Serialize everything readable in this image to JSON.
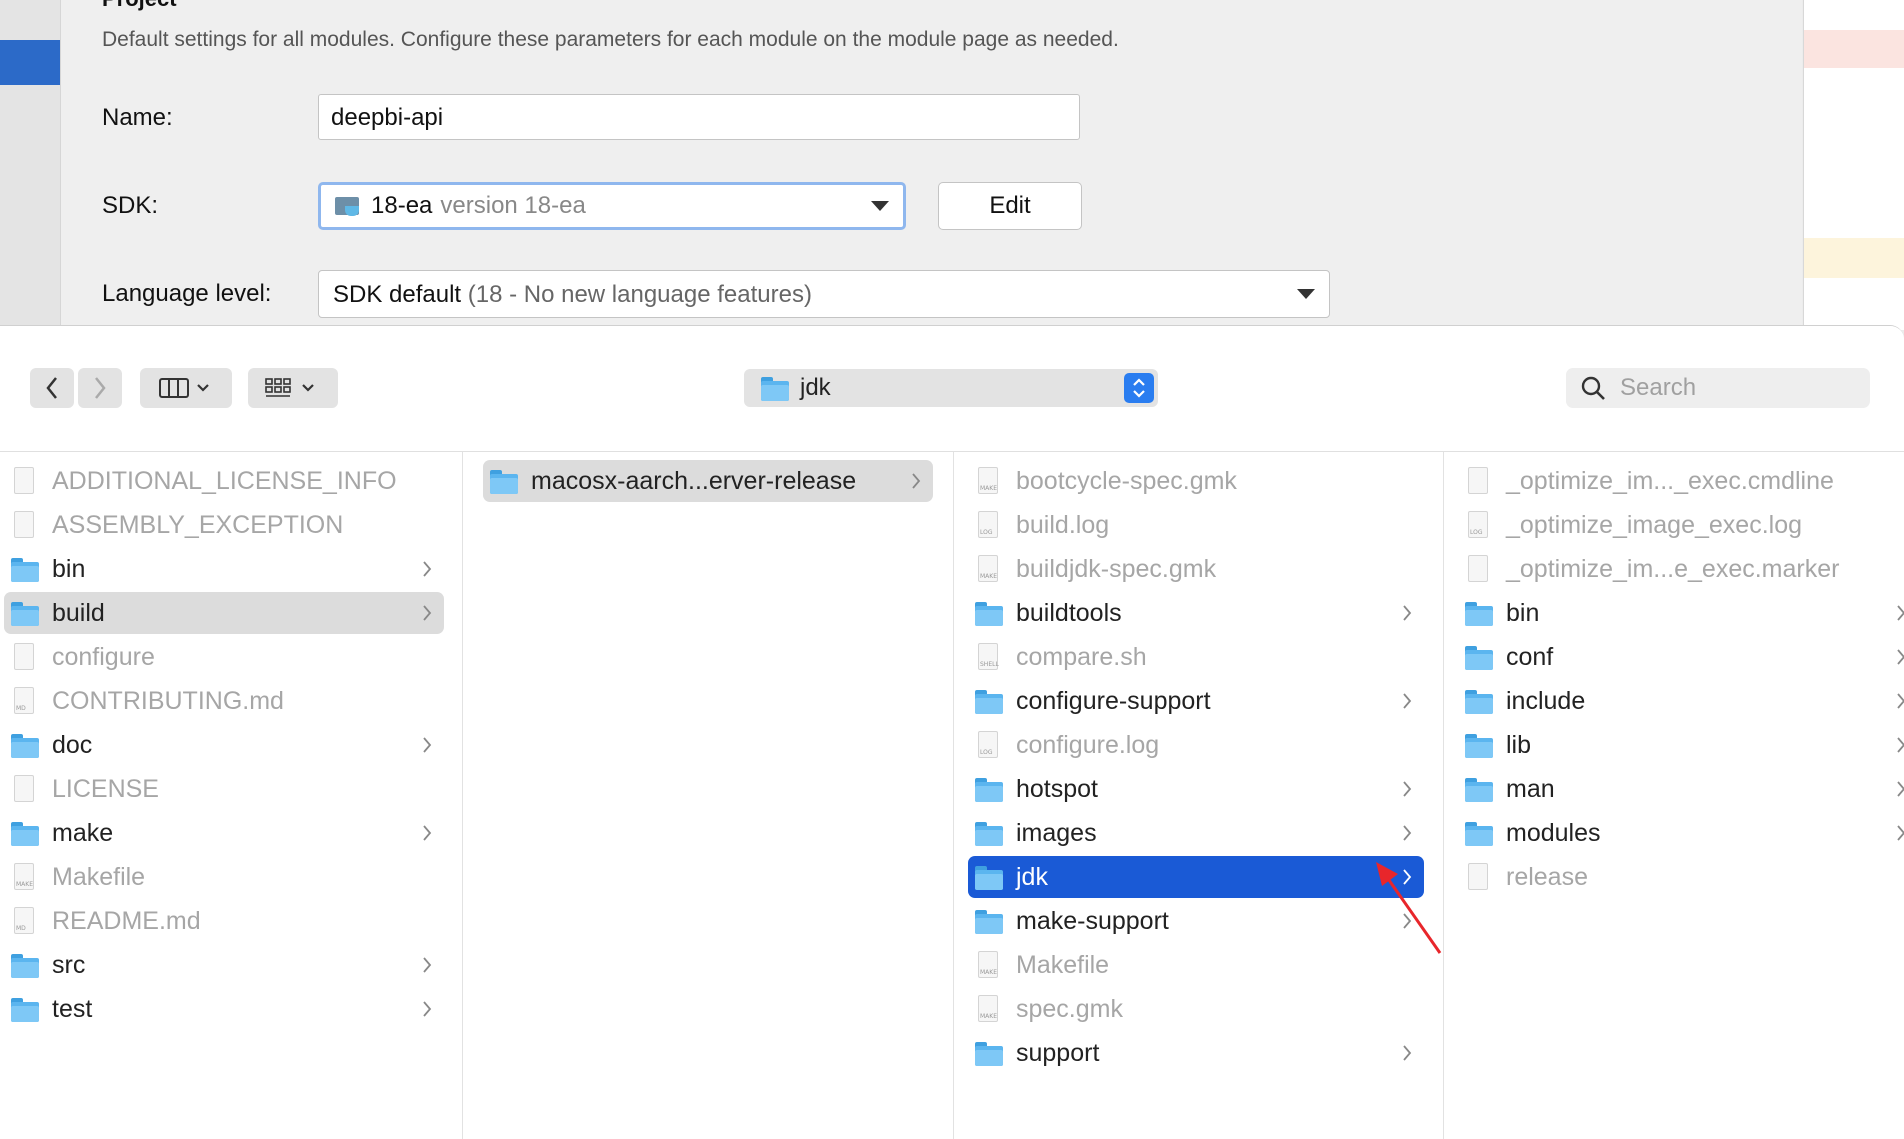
{
  "settings": {
    "section_title": "Project",
    "description": "Default settings for all modules. Configure these parameters for each module on the module page as needed.",
    "name_label": "Name:",
    "name_value": "deepbi-api",
    "sdk_label": "SDK:",
    "sdk_name": "18-ea",
    "sdk_version": "version 18-ea",
    "edit_label": "Edit",
    "language_label": "Language level:",
    "language_value": "SDK default",
    "language_detail": "(18 - No new language features)"
  },
  "finder": {
    "path_label": "jdk",
    "search_placeholder": "Search",
    "columns": [
      {
        "items": [
          {
            "label": "ADDITIONAL_LICENSE_INFO",
            "kind": "file",
            "tag": ""
          },
          {
            "label": "ASSEMBLY_EXCEPTION",
            "kind": "file",
            "tag": ""
          },
          {
            "label": "bin",
            "kind": "folder"
          },
          {
            "label": "build",
            "kind": "folder",
            "state": "highlighted"
          },
          {
            "label": "configure",
            "kind": "file",
            "tag": ""
          },
          {
            "label": "CONTRIBUTING.md",
            "kind": "file",
            "tag": "MD"
          },
          {
            "label": "doc",
            "kind": "folder"
          },
          {
            "label": "LICENSE",
            "kind": "file",
            "tag": ""
          },
          {
            "label": "make",
            "kind": "folder"
          },
          {
            "label": "Makefile",
            "kind": "file",
            "tag": "MAKE"
          },
          {
            "label": "README.md",
            "kind": "file",
            "tag": "MD"
          },
          {
            "label": "src",
            "kind": "folder"
          },
          {
            "label": "test",
            "kind": "folder"
          }
        ]
      },
      {
        "items": [
          {
            "label": "macosx-aarch...erver-release",
            "kind": "folder",
            "state": "highlighted"
          }
        ]
      },
      {
        "items": [
          {
            "label": "bootcycle-spec.gmk",
            "kind": "file",
            "tag": "MAKE"
          },
          {
            "label": "build.log",
            "kind": "file",
            "tag": "LOG"
          },
          {
            "label": "buildjdk-spec.gmk",
            "kind": "file",
            "tag": "MAKE"
          },
          {
            "label": "buildtools",
            "kind": "folder"
          },
          {
            "label": "compare.sh",
            "kind": "file",
            "tag": "SHELL"
          },
          {
            "label": "configure-support",
            "kind": "folder"
          },
          {
            "label": "configure.log",
            "kind": "file",
            "tag": "LOG"
          },
          {
            "label": "hotspot",
            "kind": "folder"
          },
          {
            "label": "images",
            "kind": "folder"
          },
          {
            "label": "jdk",
            "kind": "folder",
            "state": "selected"
          },
          {
            "label": "make-support",
            "kind": "folder"
          },
          {
            "label": "Makefile",
            "kind": "file",
            "tag": "MAKE"
          },
          {
            "label": "spec.gmk",
            "kind": "file",
            "tag": "MAKE"
          },
          {
            "label": "support",
            "kind": "folder"
          }
        ]
      },
      {
        "items": [
          {
            "label": "_optimize_im..._exec.cmdline",
            "kind": "file",
            "tag": ""
          },
          {
            "label": "_optimize_image_exec.log",
            "kind": "file",
            "tag": "LOG"
          },
          {
            "label": "_optimize_im...e_exec.marker",
            "kind": "file",
            "tag": ""
          },
          {
            "label": "bin",
            "kind": "folder"
          },
          {
            "label": "conf",
            "kind": "folder"
          },
          {
            "label": "include",
            "kind": "folder"
          },
          {
            "label": "lib",
            "kind": "folder"
          },
          {
            "label": "man",
            "kind": "folder"
          },
          {
            "label": "modules",
            "kind": "folder"
          },
          {
            "label": "release",
            "kind": "file",
            "tag": ""
          }
        ]
      }
    ]
  },
  "colors": {
    "selection": "#1a5ad6",
    "highlight": "#dcdcdc",
    "folder": "#5bb5ef",
    "annotation_arrow": "#e8262b"
  },
  "icons": {
    "back": "chevron-left-icon",
    "forward": "chevron-right-icon",
    "view": "column-view-icon",
    "group": "grid-group-icon",
    "search": "search-icon",
    "folder": "folder-icon",
    "file": "file-icon"
  }
}
